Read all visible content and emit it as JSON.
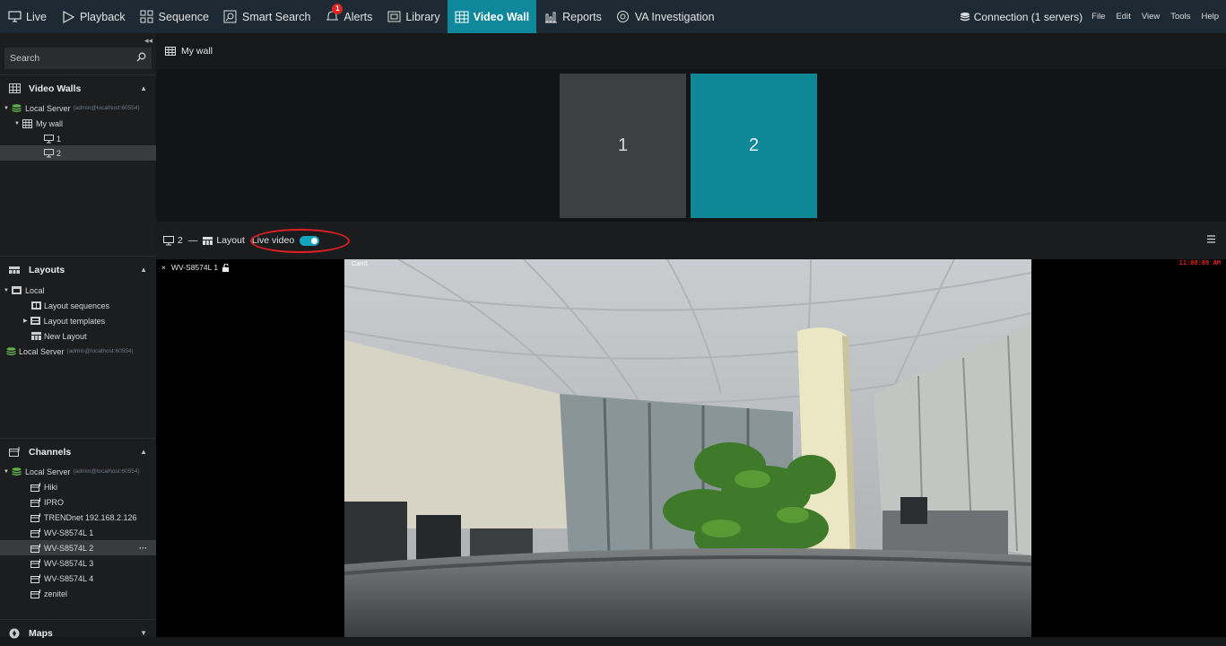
{
  "nav": {
    "items": [
      {
        "label": "Live",
        "icon": "monitor-icon"
      },
      {
        "label": "Playback",
        "icon": "play-icon"
      },
      {
        "label": "Sequence",
        "icon": "sequence-grid-icon"
      },
      {
        "label": "Smart Search",
        "icon": "smart-search-icon"
      },
      {
        "label": "Alerts",
        "icon": "bell-icon",
        "badge": "1"
      },
      {
        "label": "Library",
        "icon": "library-icon"
      },
      {
        "label": "Video Wall",
        "icon": "video-wall-icon",
        "active": true
      },
      {
        "label": "Reports",
        "icon": "reports-icon"
      },
      {
        "label": "VA Investigation",
        "icon": "va-investigation-icon"
      }
    ],
    "connection": "Connection (1 servers)",
    "menus": [
      "File",
      "Edit",
      "View",
      "Tools",
      "Help"
    ]
  },
  "sidebar": {
    "collapse": "◂◂",
    "search_placeholder": "Search",
    "video_walls": {
      "title": "Video Walls",
      "server": "Local Server",
      "server_detail": "(admin@localhost:60554)",
      "wall": "My wall",
      "screens": [
        "1",
        "2"
      ]
    },
    "layouts": {
      "title": "Layouts",
      "local": "Local",
      "items": [
        "Layout sequences",
        "Layout templates",
        "New Layout"
      ],
      "server": "Local Server",
      "server_detail": "(admin@localhost:60554)"
    },
    "channels": {
      "title": "Channels",
      "server": "Local Server",
      "server_detail": "(admin@localhost:60554)",
      "items": [
        "Hiki",
        "IPRO",
        "TRENDnet 192.168.2.126",
        "WV-S8574L 1",
        "WV-S8574L 2",
        "WV-S8574L 3",
        "WV-S8574L 4",
        "zenitel"
      ],
      "more": "···"
    },
    "maps": {
      "title": "Maps"
    }
  },
  "main": {
    "wall_title": "My wall",
    "screens": [
      {
        "label": "1"
      },
      {
        "label": "2",
        "selected": true
      }
    ],
    "screen_bar": {
      "screen": "2",
      "dash": "—",
      "layout": "Layout",
      "live_video": "Live video",
      "live_video_on": true
    },
    "video": {
      "close": "×",
      "camera": "WV-S8574L 1",
      "overlay_label": "Cam1",
      "timestamp": "11:08:08 AM"
    }
  },
  "colors": {
    "accent": "#10889c",
    "alert": "#e02424",
    "server": "#5fb04a"
  }
}
